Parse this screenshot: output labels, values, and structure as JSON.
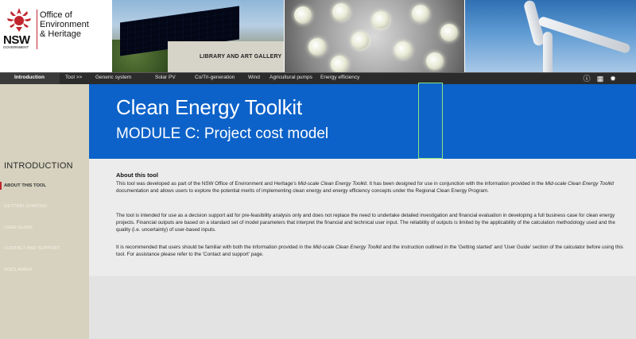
{
  "logo": {
    "nsw": "NSW",
    "government": "GOVERNMENT",
    "office_lines": [
      "Office of",
      "Environment",
      "& Heritage"
    ]
  },
  "banner": {
    "gallery_sign": "LIBRARY AND ART GALLERY"
  },
  "nav": {
    "items": [
      "Introduction",
      "Tool >>",
      "Generic system",
      "Solar PV",
      "Co/Tri-generation",
      "Wind",
      "Agricultural pumps",
      "Energy efficiency"
    ],
    "active_index": 0,
    "icons": [
      "info-icon",
      "calculator-icon",
      "gear-icon"
    ],
    "icon_glyphs": [
      "ⓘ",
      "▦",
      "✹"
    ]
  },
  "sidebar": {
    "title": "INTRODUCTION",
    "items": [
      "ABOUT THIS TOOL",
      "GETTING STARTED",
      "USER GUIDE",
      "CONTACT AND SUPPORT",
      "DISCLAIMER"
    ],
    "active_index": 0
  },
  "hero": {
    "title": "Clean Energy Toolkit",
    "subtitle": "MODULE C: Project cost model"
  },
  "content": {
    "heading": "About this tool",
    "p1_a": "This tool was developed as part of the NSW Office of Environment and Heritage's ",
    "p1_b": "Mid-scale Clean Energy Toolkit",
    "p1_c": ". It has been designed for use in conjunction with the information provided in the ",
    "p1_d": "Mid-scale Clean Energy Toolkit",
    "p1_e": " documentation and allows users to explore the potential merits of implementing clean energy and energy efficiency concepts under the Regional Clean Energy Program.",
    "p2": "The tool is intended for use as a decision support aid for pre-feasibility analysis only and does not replace the need  to undertake detailed investigation and financial evaluation in developing a full business case for clean energy projects. Financial outputs are based on a standard set of model parameters that interpret the financial and technical user input. The reliability of outputs is limited by the applicability of the calculation methodology used and the quality (i.e. uncertainty) of user-based inputs.",
    "p3_a": "It is recommended that users should be familiar with both the information provided in the ",
    "p3_b": "Mid-scale Clean Energy Toolkit",
    "p3_c": " and the instruction outlined in the 'Getting started' and 'User Guide' section of the calculator before using this tool. For assistance please refer to the 'Contact and support' page."
  },
  "colors": {
    "hero_blue": "#0c62c9",
    "nav_bg": "#2b2b2b",
    "sidebar_bg": "#d6d2bf",
    "accent_red": "#c0252e"
  }
}
